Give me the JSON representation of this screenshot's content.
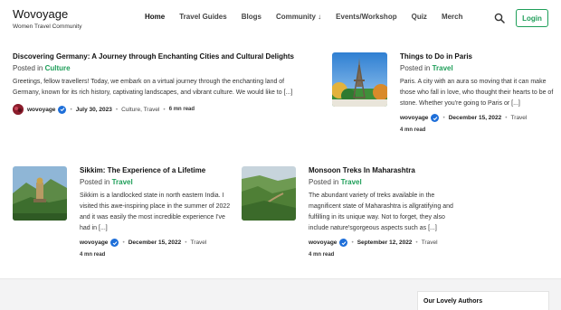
{
  "brand": {
    "name": "Wovoyage",
    "tagline": "Women Travel Community"
  },
  "nav": {
    "items": [
      {
        "label": "Home"
      },
      {
        "label": "Travel Guides"
      },
      {
        "label": "Blogs"
      },
      {
        "label": "Community ↓"
      },
      {
        "label": "Events/Workshop"
      },
      {
        "label": "Quiz"
      },
      {
        "label": "Merch"
      }
    ],
    "login_label": "Login"
  },
  "colors": {
    "accent": "#1e9e59",
    "verified": "#1e6fd9"
  },
  "posts": [
    {
      "title": "Discovering Germany: A Journey through Enchanting Cities and Cultural Delights",
      "posted_prefix": "Posted in",
      "category": "Culture",
      "excerpt": "Greetings, fellow travellers! Today, we embark on a virtual journey through the enchanting land of Germany, known for its rich history, captivating landscapes, and vibrant culture. We would like to [...]",
      "author": "wovoyage",
      "date": "July 30, 2023",
      "categories": "Culture, Travel",
      "read_time": "6 mn read"
    },
    {
      "title": "Things to Do in Paris",
      "posted_prefix": "Posted in",
      "category": "Travel",
      "excerpt": "Paris. A city with an aura so moving that it can make those who fall in love, who thought their hearts to be of stone. Whether you're going to Paris or [...]",
      "author": "wovoyage",
      "date": "December 15, 2022",
      "categories": "Travel",
      "read_time": "4 mn read"
    },
    {
      "title": "Sikkim: The Experience of a Lifetime",
      "posted_prefix": "Posted in",
      "category": "Travel",
      "excerpt": "Sikkim is a landlocked state in north eastern India. I visited this awe-inspiring place in the summer of 2022 and it was easily the most incredible experience I've had in [...]",
      "author": "wovoyage",
      "date": "December 15, 2022",
      "categories": "Travel",
      "read_time": "4 mn read"
    },
    {
      "title": "Monsoon Treks In Maharashtra",
      "posted_prefix": "Posted in",
      "category": "Travel",
      "excerpt": "The abundant variety of treks available in the magnificent state of Maharashtra is allgratifying and fulfilling in its unique way. Not to forget, they also include nature'sgorgeous aspects such as [...]",
      "author": "wovoyage",
      "date": "September 12, 2022",
      "categories": "Travel",
      "read_time": "4 mn read"
    }
  ],
  "sidebar": {
    "authors_title": "Our Lovely Authors"
  }
}
